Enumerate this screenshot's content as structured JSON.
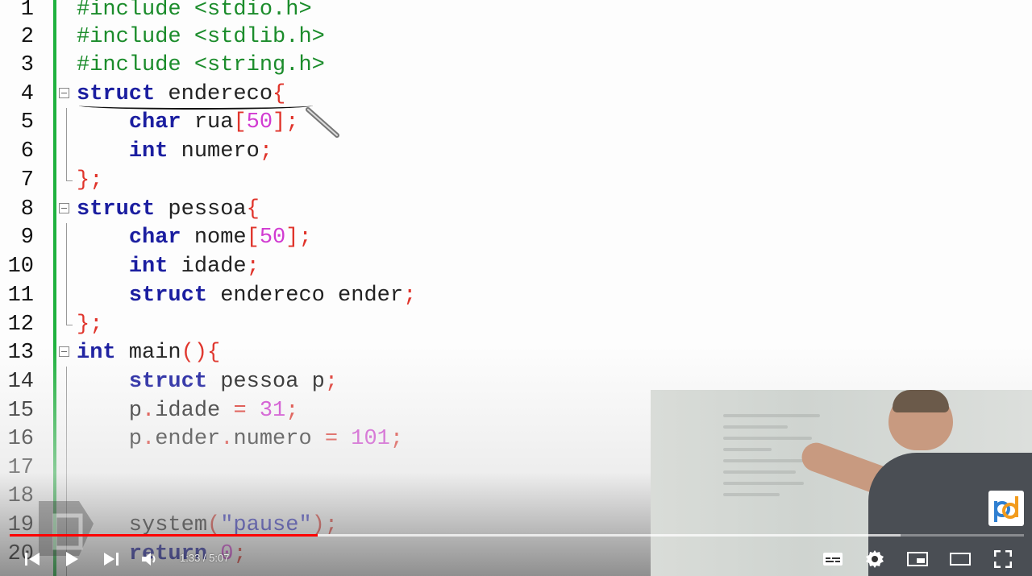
{
  "editor": {
    "lines": [
      {
        "num": "1",
        "tokens": [
          {
            "t": "#include <stdio.h>",
            "c": "pp"
          }
        ]
      },
      {
        "num": "2",
        "tokens": [
          {
            "t": "#include <stdlib.h>",
            "c": "pp"
          }
        ]
      },
      {
        "num": "3",
        "tokens": [
          {
            "t": "#include <string.h>",
            "c": "pp"
          }
        ]
      },
      {
        "num": "4",
        "fold": true,
        "tokens": [
          {
            "t": "struct",
            "c": "kw"
          },
          {
            "t": " endereco",
            "c": ""
          },
          {
            "t": "{",
            "c": "op"
          }
        ]
      },
      {
        "num": "5",
        "tokens": [
          {
            "t": "    ",
            "c": ""
          },
          {
            "t": "char",
            "c": "kw"
          },
          {
            "t": " rua",
            "c": ""
          },
          {
            "t": "[",
            "c": "op"
          },
          {
            "t": "50",
            "c": "num"
          },
          {
            "t": "];",
            "c": "op"
          }
        ]
      },
      {
        "num": "6",
        "tokens": [
          {
            "t": "    ",
            "c": ""
          },
          {
            "t": "int",
            "c": "kw"
          },
          {
            "t": " numero",
            "c": ""
          },
          {
            "t": ";",
            "c": "op"
          }
        ]
      },
      {
        "num": "7",
        "tokens": [
          {
            "t": "};",
            "c": "op"
          }
        ]
      },
      {
        "num": "8",
        "fold": true,
        "tokens": [
          {
            "t": "struct",
            "c": "kw"
          },
          {
            "t": " pessoa",
            "c": ""
          },
          {
            "t": "{",
            "c": "op"
          }
        ]
      },
      {
        "num": "9",
        "tokens": [
          {
            "t": "    ",
            "c": ""
          },
          {
            "t": "char",
            "c": "kw"
          },
          {
            "t": " nome",
            "c": ""
          },
          {
            "t": "[",
            "c": "op"
          },
          {
            "t": "50",
            "c": "num"
          },
          {
            "t": "];",
            "c": "op"
          }
        ]
      },
      {
        "num": "10",
        "tokens": [
          {
            "t": "    ",
            "c": ""
          },
          {
            "t": "int",
            "c": "kw"
          },
          {
            "t": " idade",
            "c": ""
          },
          {
            "t": ";",
            "c": "op"
          }
        ]
      },
      {
        "num": "11",
        "tokens": [
          {
            "t": "    ",
            "c": ""
          },
          {
            "t": "struct",
            "c": "kw"
          },
          {
            "t": " endereco ender",
            "c": ""
          },
          {
            "t": ";",
            "c": "op"
          }
        ]
      },
      {
        "num": "12",
        "tokens": [
          {
            "t": "};",
            "c": "op"
          }
        ]
      },
      {
        "num": "13",
        "fold": true,
        "tokens": [
          {
            "t": "int",
            "c": "kw"
          },
          {
            "t": " main",
            "c": ""
          },
          {
            "t": "(){",
            "c": "op"
          }
        ]
      },
      {
        "num": "14",
        "tokens": [
          {
            "t": "    ",
            "c": ""
          },
          {
            "t": "struct",
            "c": "kw"
          },
          {
            "t": " pessoa p",
            "c": ""
          },
          {
            "t": ";",
            "c": "op"
          }
        ]
      },
      {
        "num": "15",
        "tokens": [
          {
            "t": "    p",
            "c": ""
          },
          {
            "t": ".",
            "c": "op"
          },
          {
            "t": "idade ",
            "c": ""
          },
          {
            "t": "=",
            "c": "op"
          },
          {
            "t": " 31",
            "c": "num"
          },
          {
            "t": ";",
            "c": "op"
          }
        ]
      },
      {
        "num": "16",
        "tokens": [
          {
            "t": "    p",
            "c": ""
          },
          {
            "t": ".",
            "c": "op"
          },
          {
            "t": "ender",
            "c": ""
          },
          {
            "t": ".",
            "c": "op"
          },
          {
            "t": "numero ",
            "c": ""
          },
          {
            "t": "=",
            "c": "op"
          },
          {
            "t": " 101",
            "c": "num"
          },
          {
            "t": ";",
            "c": "op"
          }
        ]
      },
      {
        "num": "17",
        "tokens": []
      },
      {
        "num": "18",
        "tokens": []
      },
      {
        "num": "19",
        "tokens": [
          {
            "t": "    system",
            "c": ""
          },
          {
            "t": "(",
            "c": "op"
          },
          {
            "t": "\"pause\"",
            "c": "str"
          },
          {
            "t": ");",
            "c": "op"
          }
        ]
      },
      {
        "num": "20",
        "tokens": [
          {
            "t": "    ",
            "c": ""
          },
          {
            "t": "return",
            "c": "kw"
          },
          {
            "t": " 0",
            "c": "num"
          },
          {
            "t": ";",
            "c": "op"
          }
        ]
      }
    ]
  },
  "player": {
    "time_display": "1:33 / 5:07",
    "played_fraction": 0.304,
    "buffered_fraction": 0.878,
    "accent_color": "#ff0000"
  },
  "controls": {
    "icons": [
      "previous-icon",
      "play-icon",
      "next-icon",
      "volume-icon",
      "subtitles-icon",
      "settings-icon",
      "miniplayer-icon",
      "theater-mode-icon",
      "fullscreen-icon"
    ]
  }
}
